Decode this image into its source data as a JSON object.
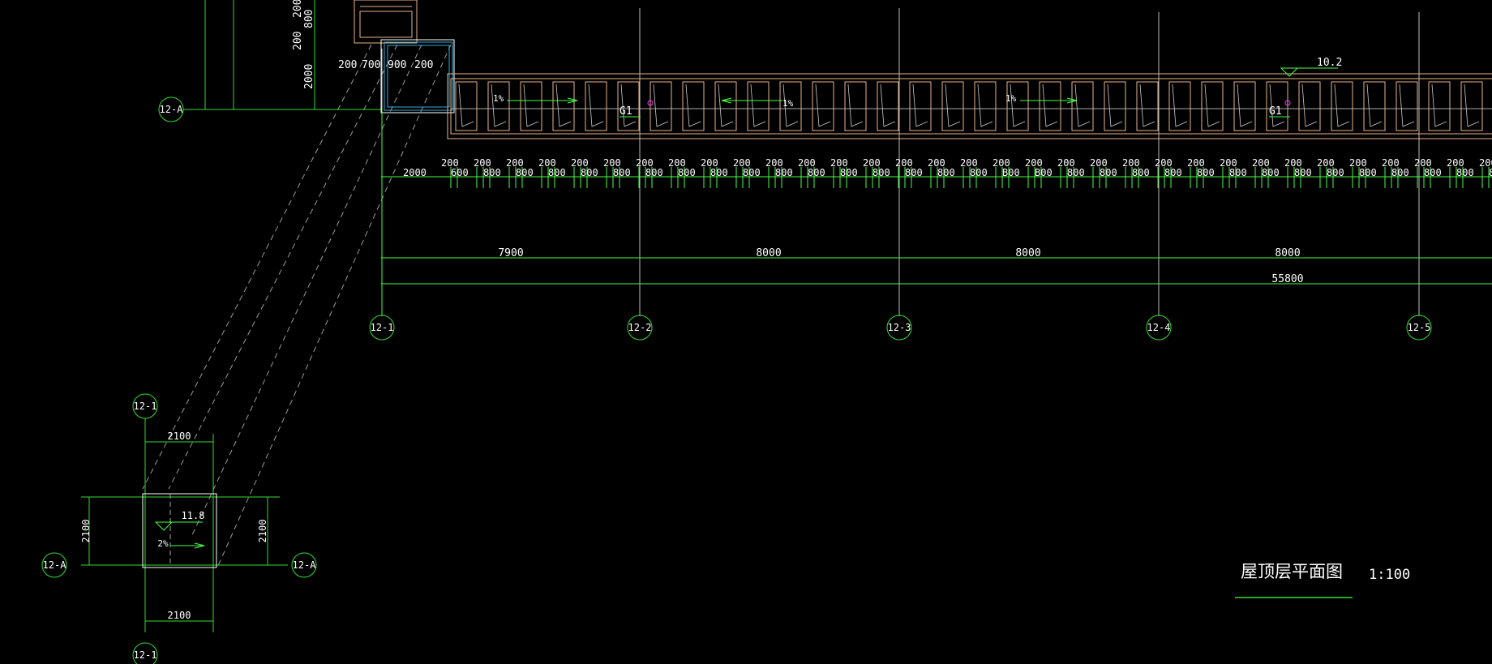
{
  "colors": {
    "background": "#000000",
    "grid": "#33dd33",
    "dim": "#44ff44",
    "outline": "#e8b48a",
    "axis": "#bbbbbb",
    "blue": "#33aadd",
    "magenta": "#ff33ff",
    "text": "#ffffff"
  },
  "bubbles": {
    "main": [
      "12-1",
      "12-2",
      "12-3",
      "12-4",
      "12-5"
    ],
    "top_row": "12-A",
    "small_top": "12-1",
    "small_bottom": "12-1",
    "small_left": "12-A",
    "small_right": "12-A"
  },
  "top_stack_dims": {
    "v1": "200",
    "v2": "800",
    "v3": "200",
    "v4": "2000"
  },
  "corner_dims": [
    "200",
    "700",
    "900",
    "200"
  ],
  "row_dims": {
    "first": "2000",
    "pairs_top": [
      "200",
      "200",
      "200",
      "200",
      "200",
      "200",
      "200",
      "200",
      "200",
      "200",
      "200",
      "200",
      "200",
      "200",
      "200",
      "200",
      "200",
      "200",
      "200",
      "200",
      "200",
      "200",
      "200",
      "200",
      "200",
      "200",
      "200",
      "200",
      "200",
      "200",
      "200",
      "200",
      "200"
    ],
    "spans": [
      "600",
      "800",
      "800",
      "800",
      "800",
      "800",
      "800",
      "800",
      "800",
      "800",
      "800",
      "800",
      "800",
      "800",
      "800",
      "800",
      "800",
      "B00",
      "B00",
      "800",
      "800",
      "800",
      "800",
      "800",
      "800",
      "800",
      "800",
      "800",
      "800",
      "800",
      "800",
      "800",
      "800"
    ]
  },
  "bay_dims": [
    "7900",
    "8000",
    "8000",
    "8000"
  ],
  "total_dim": "55800",
  "roof": {
    "slopes": [
      "1%",
      "1%",
      "1%"
    ],
    "gutter_labels": [
      "G1",
      "G1"
    ],
    "elevation": "10.2"
  },
  "small_plan": {
    "top_dim": "2100",
    "bottom_dim": "2100",
    "left_dim": "2100",
    "right_dim": "2100",
    "elevation": "11.8",
    "slope": "2%"
  },
  "title": {
    "name": "屋顶层平面图",
    "scale": "1:100"
  }
}
